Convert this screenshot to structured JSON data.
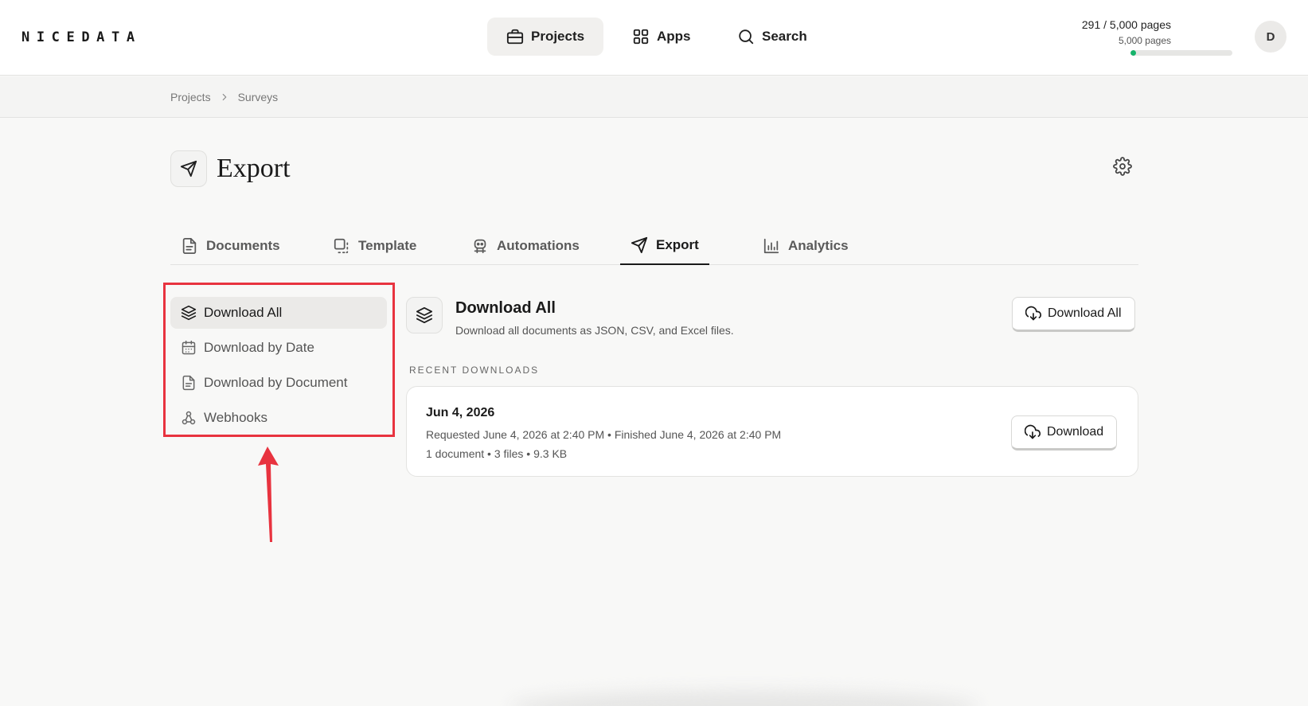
{
  "app": {
    "logo": "NICEDATA"
  },
  "nav": {
    "projects": "Projects",
    "apps": "Apps",
    "search": "Search"
  },
  "usage": {
    "main": "291 / 5,000 pages",
    "sub": "5,000 pages",
    "fraction": 0.0582
  },
  "user": {
    "avatar_initial": "D"
  },
  "breadcrumb": {
    "items": [
      "Projects",
      "Surveys"
    ]
  },
  "page": {
    "title": "Export"
  },
  "tabs": [
    {
      "label": "Documents",
      "icon": "document-icon"
    },
    {
      "label": "Template",
      "icon": "template-icon"
    },
    {
      "label": "Automations",
      "icon": "robot-icon"
    },
    {
      "label": "Export",
      "icon": "send-icon",
      "active": true
    },
    {
      "label": "Analytics",
      "icon": "bar-chart-icon"
    }
  ],
  "sidebar": {
    "items": [
      {
        "label": "Download All",
        "icon": "layers-icon",
        "active": true
      },
      {
        "label": "Download by Date",
        "icon": "calendar-icon"
      },
      {
        "label": "Download by Document",
        "icon": "document-icon"
      },
      {
        "label": "Webhooks",
        "icon": "webhook-icon"
      }
    ]
  },
  "section": {
    "title": "Download All",
    "description": "Download all documents as JSON, CSV, and Excel files.",
    "button_label": "Download All"
  },
  "recent": {
    "label": "RECENT DOWNLOADS",
    "items": [
      {
        "date": "Jun 4, 2026",
        "line1": "Requested June 4, 2026 at 2:40 PM • Finished June 4, 2026 at 2:40 PM",
        "line2": "1 document • 3 files • 9.3 KB",
        "button_label": "Download"
      }
    ]
  },
  "colors": {
    "accent_green": "#16b36b",
    "annotation_red": "#e8333f"
  }
}
